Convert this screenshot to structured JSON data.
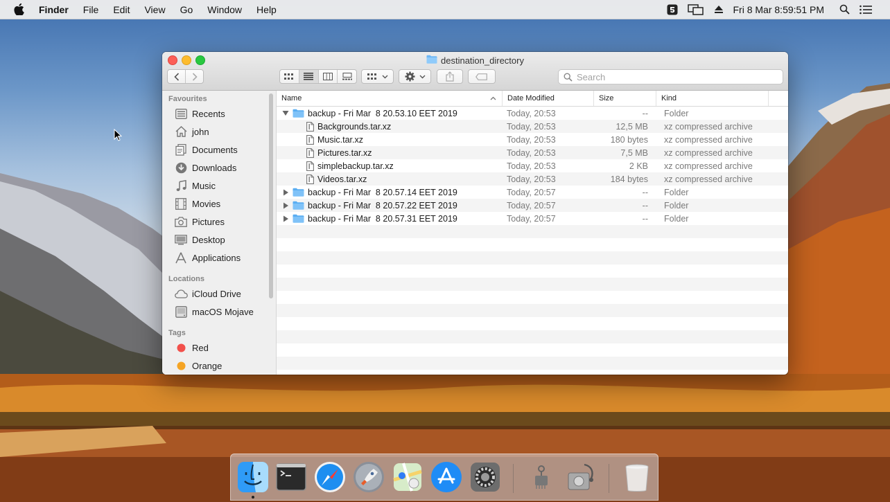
{
  "menubar": {
    "apple_icon": "apple-icon",
    "app_name": "Finder",
    "items": [
      "File",
      "Edit",
      "View",
      "Go",
      "Window",
      "Help"
    ],
    "tray_icons": [
      "scratchpad-5-icon",
      "display-mirroring-icon",
      "eject-icon"
    ],
    "clock": "Fri 8 Mar  8:59:51 PM",
    "spotlight_icon": "search-icon",
    "notification_icon": "list-icon"
  },
  "window": {
    "title": "destination_directory",
    "search_placeholder": "Search",
    "view_mode": "list"
  },
  "sidebar": {
    "favourites_header": "Favourites",
    "favourites": [
      {
        "label": "Recents",
        "icon": "recents-icon"
      },
      {
        "label": "john",
        "icon": "home-icon"
      },
      {
        "label": "Documents",
        "icon": "documents-icon"
      },
      {
        "label": "Downloads",
        "icon": "downloads-icon"
      },
      {
        "label": "Music",
        "icon": "music-icon"
      },
      {
        "label": "Movies",
        "icon": "movies-icon"
      },
      {
        "label": "Pictures",
        "icon": "pictures-icon"
      },
      {
        "label": "Desktop",
        "icon": "desktop-icon"
      },
      {
        "label": "Applications",
        "icon": "applications-icon"
      }
    ],
    "locations_header": "Locations",
    "locations": [
      {
        "label": "iCloud Drive",
        "icon": "cloud-icon"
      },
      {
        "label": "macOS Mojave",
        "icon": "disk-icon"
      }
    ],
    "tags_header": "Tags",
    "tags": [
      {
        "label": "Red",
        "color": "#f2504b"
      },
      {
        "label": "Orange",
        "color": "#f5a424"
      }
    ]
  },
  "columns": {
    "name": "Name",
    "date": "Date Modified",
    "size": "Size",
    "kind": "Kind"
  },
  "files": [
    {
      "name": "backup - Fri Mar  8 20.53.10 EET 2019",
      "date": "Today, 20:53",
      "size": "--",
      "kind": "Folder",
      "type": "folder",
      "expanded": true,
      "depth": 0
    },
    {
      "name": "Backgrounds.tar.xz",
      "date": "Today, 20:53",
      "size": "12,5 MB",
      "kind": "xz compressed archive",
      "type": "file",
      "depth": 1
    },
    {
      "name": "Music.tar.xz",
      "date": "Today, 20:53",
      "size": "180 bytes",
      "kind": "xz compressed archive",
      "type": "file",
      "depth": 1
    },
    {
      "name": "Pictures.tar.xz",
      "date": "Today, 20:53",
      "size": "7,5 MB",
      "kind": "xz compressed archive",
      "type": "file",
      "depth": 1
    },
    {
      "name": "simplebackup.tar.xz",
      "date": "Today, 20:53",
      "size": "2 KB",
      "kind": "xz compressed archive",
      "type": "file",
      "depth": 1
    },
    {
      "name": "Videos.tar.xz",
      "date": "Today, 20:53",
      "size": "184 bytes",
      "kind": "xz compressed archive",
      "type": "file",
      "depth": 1
    },
    {
      "name": "backup - Fri Mar  8 20.57.14 EET 2019",
      "date": "Today, 20:57",
      "size": "--",
      "kind": "Folder",
      "type": "folder",
      "expanded": false,
      "depth": 0
    },
    {
      "name": "backup - Fri Mar  8 20.57.22 EET 2019",
      "date": "Today, 20:57",
      "size": "--",
      "kind": "Folder",
      "type": "folder",
      "expanded": false,
      "depth": 0
    },
    {
      "name": "backup - Fri Mar  8 20.57.31 EET 2019",
      "date": "Today, 20:57",
      "size": "--",
      "kind": "Folder",
      "type": "folder",
      "expanded": false,
      "depth": 0
    }
  ],
  "dock": {
    "apps": [
      {
        "name": "finder-icon",
        "running": true
      },
      {
        "name": "terminal-icon",
        "running": false
      },
      {
        "name": "safari-icon",
        "running": false
      },
      {
        "name": "launchpad-icon",
        "running": false
      },
      {
        "name": "maps-icon",
        "running": false
      },
      {
        "name": "app-store-icon",
        "running": false
      },
      {
        "name": "system-preferences-icon",
        "running": false
      },
      {
        "name": "system-information-icon",
        "running": false
      },
      {
        "name": "disk-utility-icon",
        "running": false
      },
      {
        "name": "trash-icon",
        "running": false
      }
    ]
  },
  "colors": {
    "accent": "#1a82fb",
    "folder": "#6cb6f5"
  }
}
